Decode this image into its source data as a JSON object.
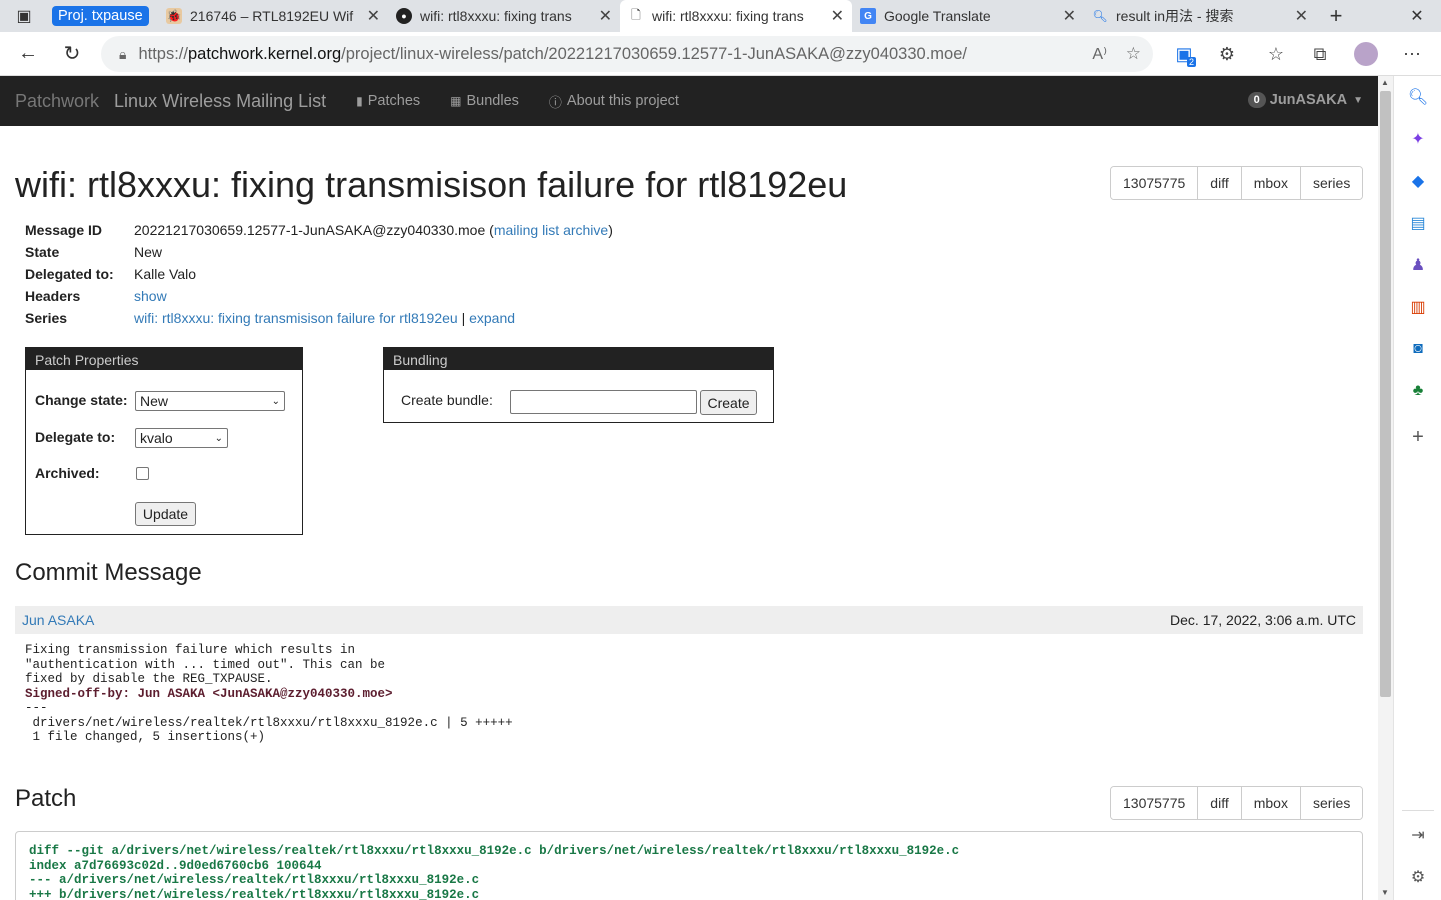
{
  "browser": {
    "tabs": [
      {
        "label": "Proj. txpause",
        "kind": "group"
      },
      {
        "label": "216746 – RTL8192EU Wif",
        "icon": "bugzilla-icon"
      },
      {
        "label": "wifi: rtl8xxxu: fixing trans",
        "icon": "github-icon"
      },
      {
        "label": "wifi: rtl8xxxu: fixing trans",
        "icon": "page-icon",
        "active": true
      },
      {
        "label": "Google Translate",
        "icon": "google-translate-icon"
      },
      {
        "label": "result in用法 - 搜索",
        "icon": "search-icon"
      }
    ],
    "url_prefix": "https://",
    "url_host": "patchwork.kernel.org",
    "url_path": "/project/linux-wireless/patch/20221217030659.12577-1-JunASAKA@zzy040330.moe/",
    "extensions_count": "2"
  },
  "nav": {
    "brand": "Patchwork",
    "project": "Linux Wireless Mailing List",
    "links": [
      "Patches",
      "Bundles",
      "About this project"
    ],
    "user_badge": "0",
    "user": "JunASAKA"
  },
  "patch": {
    "title": "wifi: rtl8xxxu: fixing transmisison failure for rtl8192eu",
    "buttons": [
      "13075775",
      "diff",
      "mbox",
      "series"
    ],
    "meta": {
      "message_id_label": "Message ID",
      "message_id": "20221217030659.12577-1-JunASAKA@zzy040330.moe",
      "archive_link": "mailing list archive",
      "state_label": "State",
      "state": "New",
      "delegated_label": "Delegated to:",
      "delegated": "Kalle Valo",
      "headers_label": "Headers",
      "headers_link": "show",
      "series_label": "Series",
      "series_link": "wifi: rtl8xxxu: fixing transmisison failure for rtl8192eu",
      "expand_link": "expand"
    }
  },
  "properties": {
    "title": "Patch Properties",
    "change_state_label": "Change state:",
    "change_state_value": "New",
    "delegate_label": "Delegate to:",
    "delegate_value": "kvalo",
    "archived_label": "Archived:",
    "update_button": "Update"
  },
  "bundling": {
    "title": "Bundling",
    "create_label": "Create bundle:",
    "create_button": "Create"
  },
  "commit": {
    "heading": "Commit Message",
    "author": "Jun ASAKA",
    "date": "Dec. 17, 2022, 3:06 a.m. UTC",
    "body": "Fixing transmission failure which results in\n\"authentication with ... timed out\". This can be\nfixed by disable the REG_TXPAUSE.\n",
    "signoff": "Signed-off-by: Jun ASAKA <JunASAKA@zzy040330.moe>",
    "stat": "---\n drivers/net/wireless/realtek/rtl8xxxu/rtl8xxxu_8192e.c | 5 +++++\n 1 file changed, 5 insertions(+)"
  },
  "patch_section": {
    "heading": "Patch",
    "diff": "diff --git a/drivers/net/wireless/realtek/rtl8xxxu/rtl8xxxu_8192e.c b/drivers/net/wireless/realtek/rtl8xxxu/rtl8xxxu_8192e.c\nindex a7d76693c02d..9d0ed6760cb6 100644\n--- a/drivers/net/wireless/realtek/rtl8xxxu/rtl8xxxu_8192e.c\n+++ b/drivers/net/wireless/realtek/rtl8xxxu/rtl8xxxu_8192e.c"
  }
}
